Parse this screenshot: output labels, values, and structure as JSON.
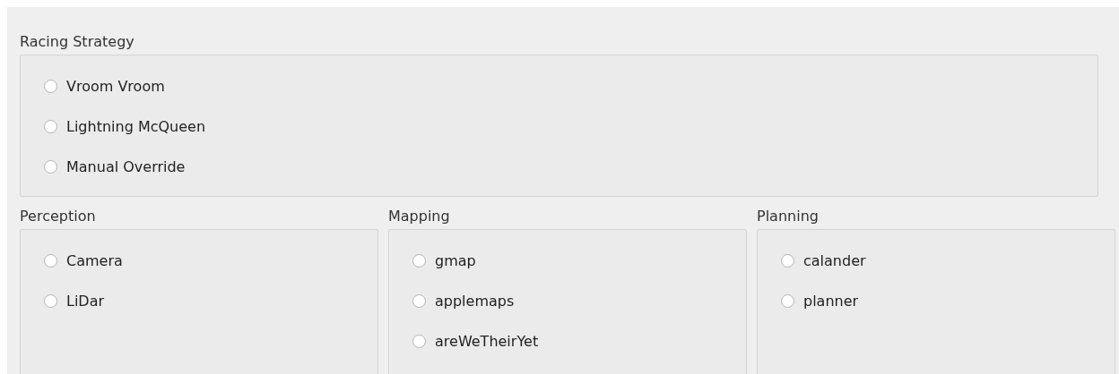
{
  "top_group": {
    "title": "Racing Strategy",
    "options": [
      {
        "label": "Vroom Vroom",
        "selected": false
      },
      {
        "label": "Lightning McQueen",
        "selected": false
      },
      {
        "label": "Manual Override",
        "selected": false
      }
    ]
  },
  "groups": [
    {
      "title": "Perception",
      "options": [
        {
          "label": "Camera",
          "selected": false
        },
        {
          "label": "LiDar",
          "selected": false
        }
      ]
    },
    {
      "title": "Mapping",
      "options": [
        {
          "label": "gmap",
          "selected": false
        },
        {
          "label": "applemaps",
          "selected": false
        },
        {
          "label": "areWeTheirYet",
          "selected": false
        }
      ]
    },
    {
      "title": "Planning",
      "options": [
        {
          "label": "calander",
          "selected": false
        },
        {
          "label": "planner",
          "selected": false
        }
      ]
    }
  ]
}
